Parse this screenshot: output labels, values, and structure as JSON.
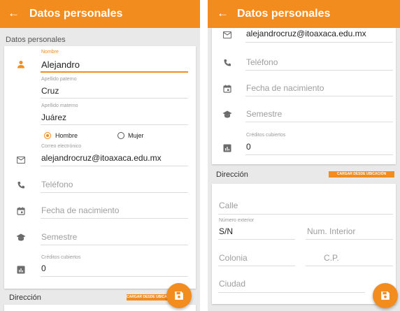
{
  "left": {
    "appbar": {
      "back_glyph": "←",
      "title": "Datos personales"
    },
    "section_title": "Datos personales",
    "fields": {
      "nombre": {
        "label": "Nombre",
        "value": "Alejandro"
      },
      "apellido_paterno": {
        "label": "Apellido paterno",
        "value": "Cruz"
      },
      "apellido_materno": {
        "label": "Apellido materno",
        "value": "Juárez"
      },
      "correo": {
        "label": "Correo electrónico",
        "value": "alejandrocruz@itoaxaca.edu.mx"
      },
      "telefono": {
        "placeholder": "Teléfono"
      },
      "fecha": {
        "placeholder": "Fecha de nacimiento"
      },
      "semestre": {
        "placeholder": "Semestre"
      },
      "creditos": {
        "label": "Créditos cubiertos",
        "value": "0"
      }
    },
    "gender": {
      "options": [
        "Hombre",
        "Mujer"
      ],
      "selected": "Hombre"
    },
    "direccion": {
      "title": "Dirección",
      "button_label": "CARGAR DESDE UBICACIÓN"
    }
  },
  "right": {
    "appbar": {
      "back_glyph": "←",
      "title": "Datos personales"
    },
    "fields": {
      "correo": {
        "value": "alejandrocruz@itoaxaca.edu.mx"
      },
      "telefono": {
        "placeholder": "Teléfono"
      },
      "fecha": {
        "placeholder": "Fecha de nacimiento"
      },
      "semestre": {
        "placeholder": "Semestre"
      },
      "creditos": {
        "label": "Créditos cubiertos",
        "value": "0"
      }
    },
    "direccion": {
      "title": "Dirección",
      "button_label": "CARGAR DESDE UBICACIÓN",
      "calle": {
        "placeholder": "Calle"
      },
      "num_exterior": {
        "label": "Número exterior",
        "value": "S/N"
      },
      "num_interior": {
        "placeholder": "Num. Interior"
      },
      "colonia": {
        "placeholder": "Colonia"
      },
      "cp": {
        "placeholder": "C.P."
      },
      "ciudad": {
        "placeholder": "Ciudad"
      }
    }
  },
  "colors": {
    "accent": "#f28c1f",
    "text": "#222222",
    "hint": "#9e9e9e",
    "background": "#e9e9e9"
  },
  "icons": [
    "back-arrow-icon",
    "person-icon",
    "email-icon",
    "phone-icon",
    "calendar-icon",
    "school-icon",
    "chart-icon",
    "save-icon"
  ]
}
